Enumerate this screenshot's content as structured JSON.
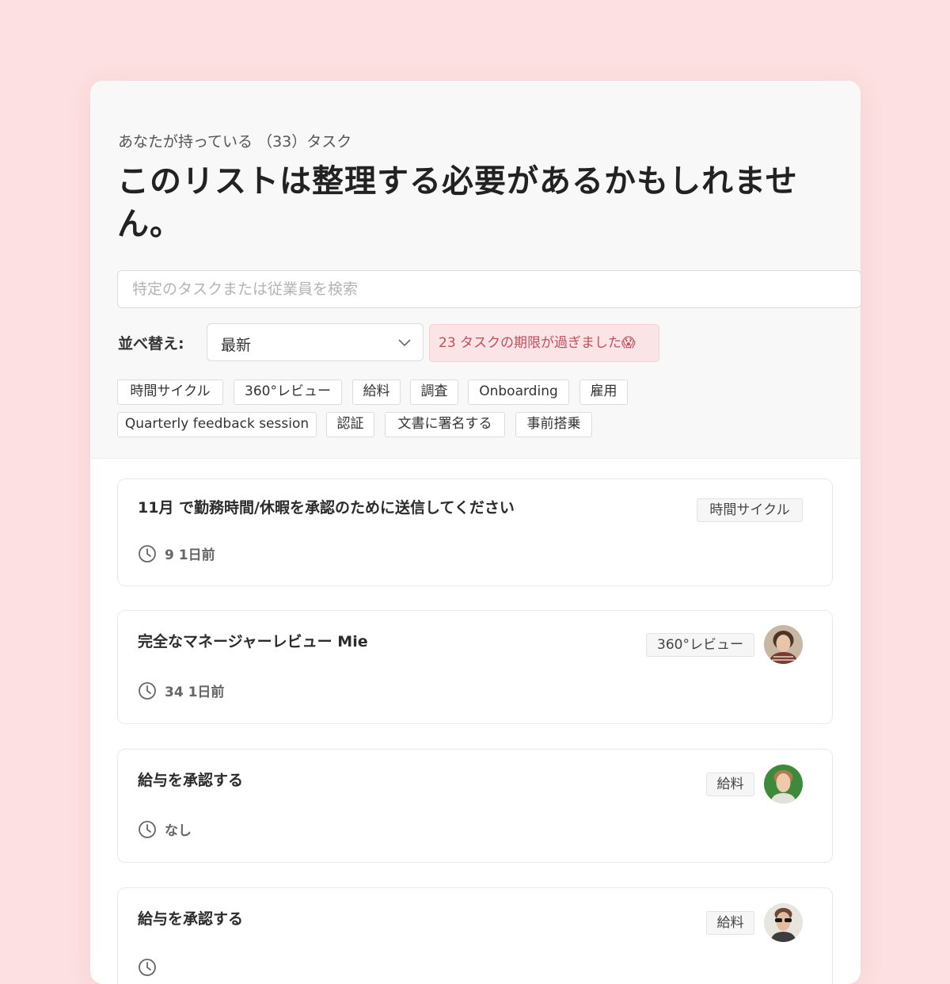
{
  "header": {
    "subtitle": "あなたが持っている （33）タスク",
    "title": "このリストは整理する必要があるかもしれません。"
  },
  "search": {
    "placeholder": "特定のタスクまたは従業員を検索",
    "value": ""
  },
  "sort": {
    "label": "並べ替え:",
    "selected": "最新"
  },
  "overdue_notice": "23 タスクの期限が過ぎました😱",
  "filter_tags": [
    "時間サイクル",
    "360°レビュー",
    "給料",
    "調査",
    "Onboarding",
    "雇用",
    "Quarterly feedback session",
    "認証",
    "文書に署名する",
    "事前搭乗"
  ],
  "tasks": [
    {
      "title": "11月 で勤務時間/休暇を承認のために送信してください",
      "due": "9 1日前",
      "tag": "時間サイクル",
      "avatar": "none"
    },
    {
      "title": "完全なマネージャーレビュー Mie",
      "due": "34 1日前",
      "tag": "360°レビュー",
      "avatar": "person-curly-hair"
    },
    {
      "title": "給与を承認する",
      "due": "なし",
      "tag": "給料",
      "avatar": "person-short-hair"
    },
    {
      "title": "給与を承認する",
      "due": "",
      "tag": "給料",
      "avatar": "person-sunglasses"
    }
  ],
  "colors": {
    "background": "#fde0e1",
    "overdue_bg": "#fbe4e5",
    "overdue_text": "#c0505a",
    "panel_header_bg": "#f8f8f8"
  }
}
